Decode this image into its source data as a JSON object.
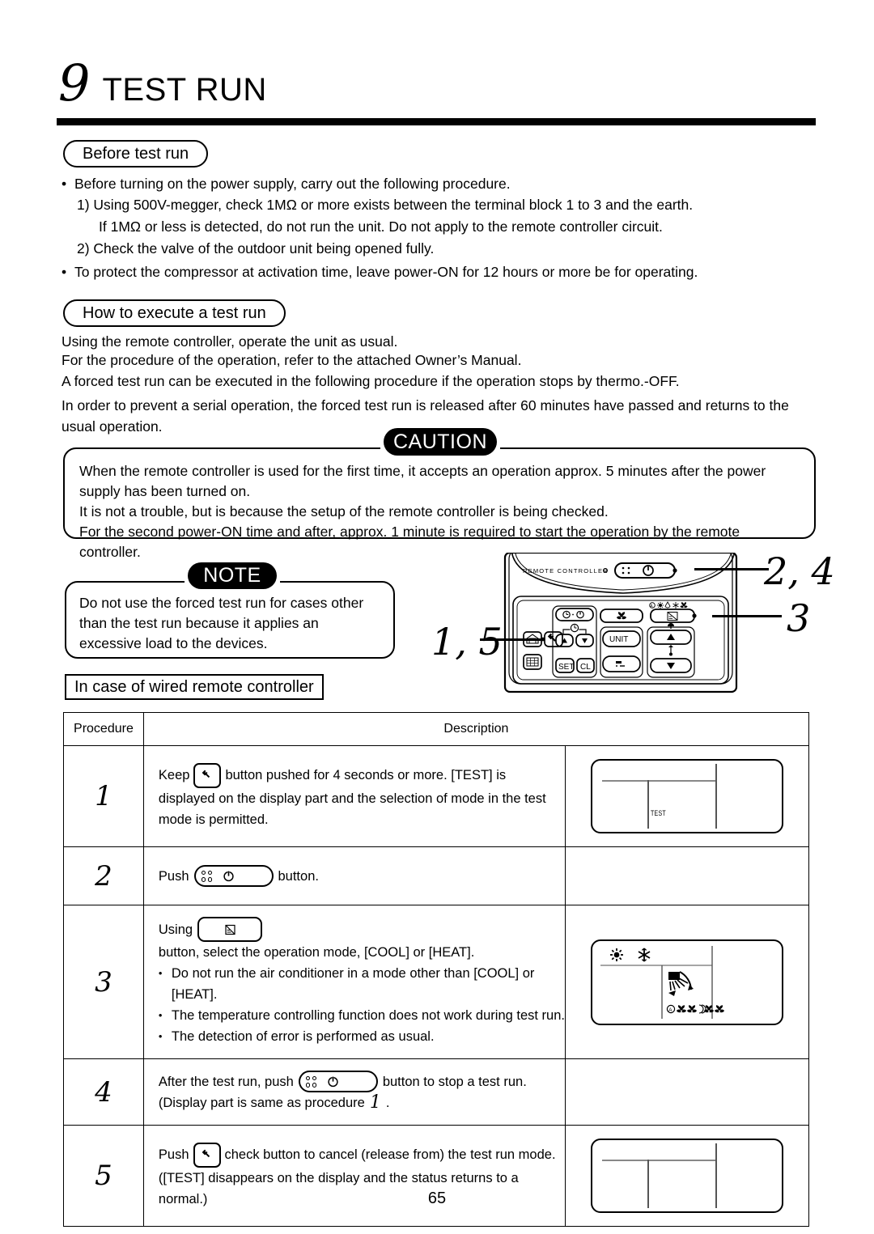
{
  "chapter": {
    "number": "9",
    "title": "TEST RUN"
  },
  "sections": {
    "before_test_run": {
      "heading": "Before test run",
      "bullet1": "Before turning on the power supply, carry out the following procedure.",
      "item1a": "1)  Using 500V-megger, check 1MΩ or more exists between the terminal block 1 to 3 and the earth.",
      "item1b": "If 1MΩ or less is detected, do not run the unit.  Do not apply to the remote controller circuit.",
      "item2": "2)  Check the valve of the outdoor unit being opened fully.",
      "bullet2": "To protect the compressor at activation time, leave power-ON for 12 hours or more be for operating."
    },
    "how_to_execute": {
      "heading": "How to execute a test run",
      "line1": "Using the remote controller, operate the unit as usual.",
      "line2": "For the procedure of the operation, refer to the attached Owner’s Manual.",
      "line3": "A forced test run can be executed in the following procedure if the operation stops by thermo.-OFF.",
      "line4": "In order to prevent a serial operation, the forced test run is released after 60 minutes have passed and returns to the usual operation."
    },
    "caution": {
      "label": "CAUTION",
      "line1": "When the remote controller is used for the first time, it accepts an operation approx. 5 minutes after the power supply has been turned on.",
      "line2": "It is not a trouble, but is because the setup of the remote controller is being checked.",
      "line3": "For the second power-ON time and after, approx. 1 minute is required to start the operation by the remote controller."
    },
    "note": {
      "label": "NOTE",
      "body": "Do not use the forced test run for cases other than the test run because it applies an excessive load to the devices."
    },
    "wired_heading": "In case of wired remote controller"
  },
  "remote": {
    "label": "REMOTE CONTROLLER",
    "buttons": {
      "unit": "UNIT",
      "set": "SET",
      "cl": "CL"
    },
    "callouts": [
      {
        "id": "callout-2-4",
        "text": "2, 4"
      },
      {
        "id": "callout-3",
        "text": "3"
      },
      {
        "id": "callout-1-5",
        "text": "1, 5"
      }
    ]
  },
  "table": {
    "headers": {
      "procedure": "Procedure",
      "description": "Description"
    },
    "rows": [
      {
        "num": "1",
        "text_a": "Keep",
        "text_b": "button pushed for 4 seconds or more.  [TEST] is",
        "text_c": "displayed on the display part and the selection of mode in the test mode is permitted.",
        "display": "TEST"
      },
      {
        "num": "2",
        "text_a": "Push",
        "text_b": "button."
      },
      {
        "num": "3",
        "text_a": "Using",
        "text_b": "button, select the operation mode, [COOL] or [HEAT].",
        "li1": "Do not run the air conditioner in a mode other than [COOL] or [HEAT].",
        "li2": "The temperature controlling function does not work during test run.",
        "li3": "The detection of error is performed as usual."
      },
      {
        "num": "4",
        "text_a": "After the test run, push",
        "text_b": "button to stop a test run.",
        "text_c": "(Display part is same as procedure",
        "text_d": "1",
        "text_e": "."
      },
      {
        "num": "5",
        "text_a": "Push",
        "text_b": "check button to cancel (release from) the test run mode.",
        "text_c": "([TEST] disappears on the display and the status returns to a normal.)"
      }
    ]
  },
  "page_number": "65"
}
